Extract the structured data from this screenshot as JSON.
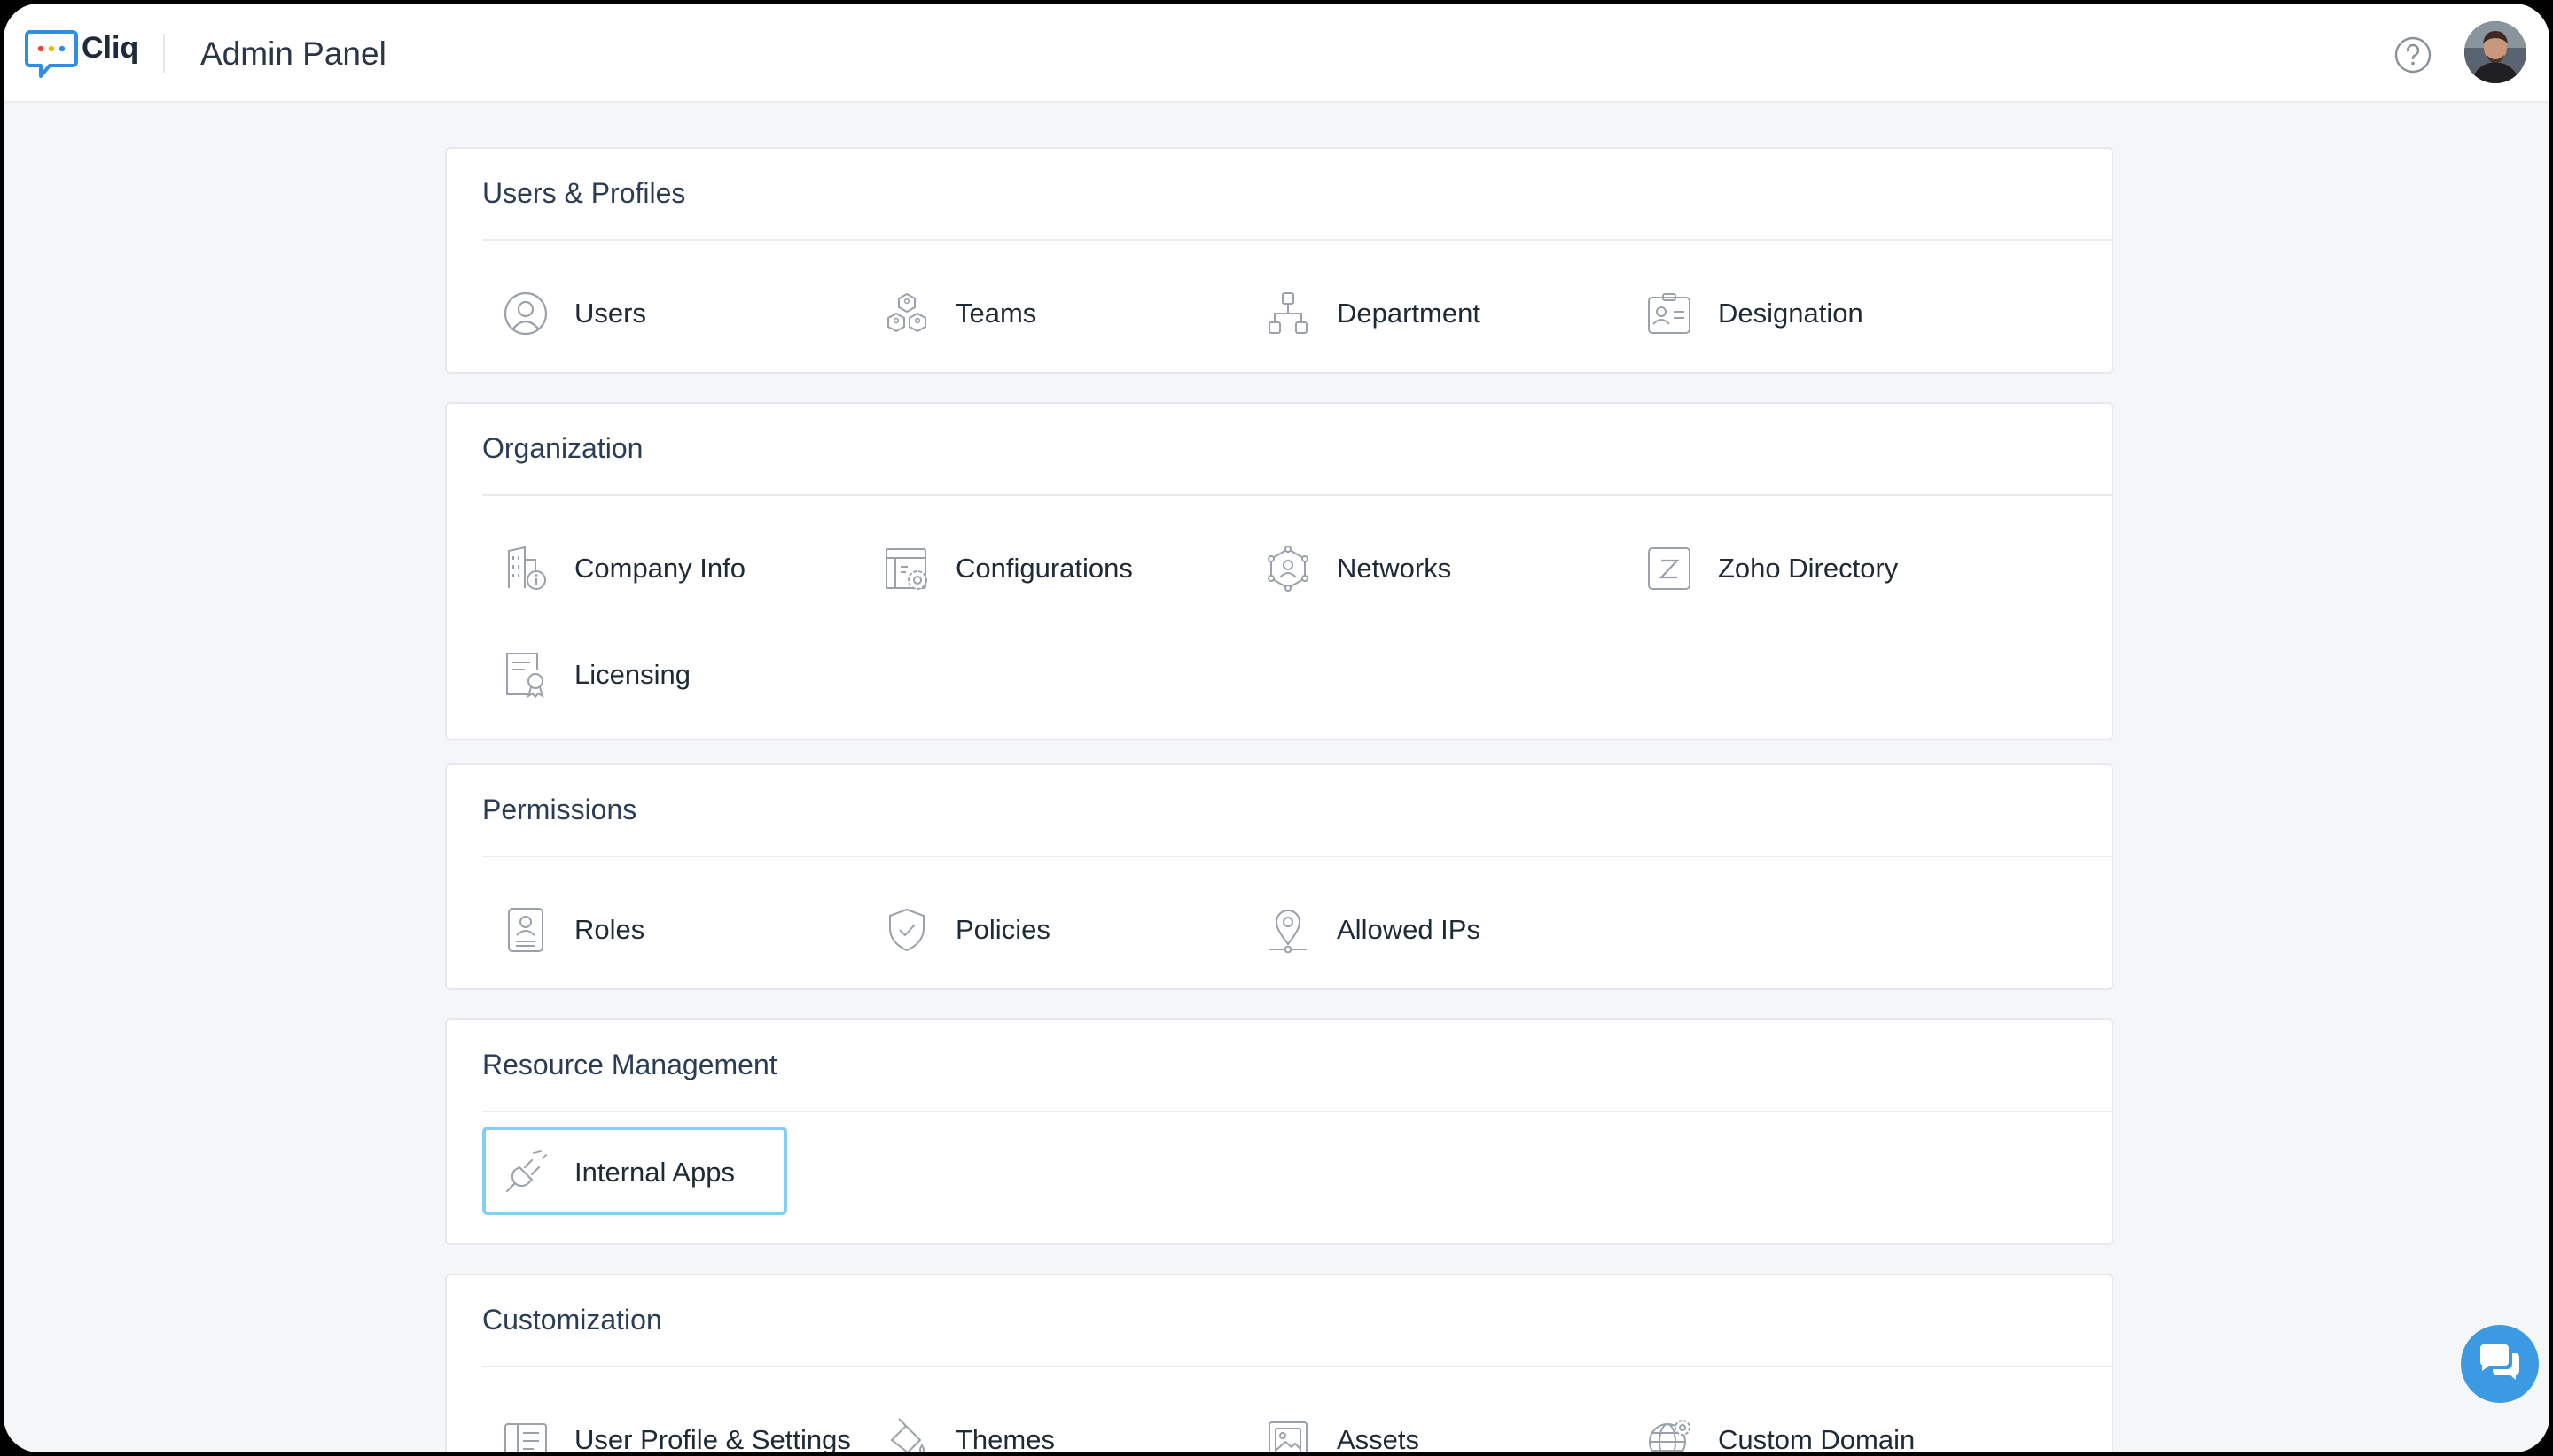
{
  "header": {
    "brand": "Cliq",
    "title": "Admin Panel",
    "help_icon": "help-circle-icon",
    "avatar_icon": "user-avatar"
  },
  "sections": [
    {
      "title": "Users & Profiles",
      "items": [
        {
          "label": "Users",
          "icon": "user-circle-icon"
        },
        {
          "label": "Teams",
          "icon": "teams-icon"
        },
        {
          "label": "Department",
          "icon": "org-chart-icon"
        },
        {
          "label": "Designation",
          "icon": "id-badge-icon"
        }
      ]
    },
    {
      "title": "Organization",
      "items": [
        {
          "label": "Company Info",
          "icon": "building-info-icon"
        },
        {
          "label": "Configurations",
          "icon": "config-gear-icon"
        },
        {
          "label": "Networks",
          "icon": "network-icon"
        },
        {
          "label": "Zoho Directory",
          "icon": "z-directory-icon"
        },
        {
          "label": "Licensing",
          "icon": "license-certificate-icon"
        }
      ]
    },
    {
      "title": "Permissions",
      "items": [
        {
          "label": "Roles",
          "icon": "role-badge-icon"
        },
        {
          "label": "Policies",
          "icon": "shield-check-icon"
        },
        {
          "label": "Allowed IPs",
          "icon": "location-pin-icon"
        }
      ]
    },
    {
      "title": "Resource Management",
      "items": [
        {
          "label": "Internal Apps",
          "icon": "plug-icon"
        }
      ]
    },
    {
      "title": "Customization",
      "items": [
        {
          "label": "User Profile & Settings",
          "icon": "profile-layout-icon"
        },
        {
          "label": "Themes",
          "icon": "paint-bucket-icon"
        },
        {
          "label": "Assets",
          "icon": "image-assets-icon"
        },
        {
          "label": "Custom Domain",
          "icon": "globe-gear-icon"
        }
      ]
    }
  ],
  "chat_widget": {
    "icon": "chat-bubbles-icon"
  },
  "colors": {
    "accent": "#3b9ae1",
    "focus_outline": "#86cdf3",
    "section_title": "#2a3d55",
    "icon_stroke": "#9aa1ab"
  }
}
